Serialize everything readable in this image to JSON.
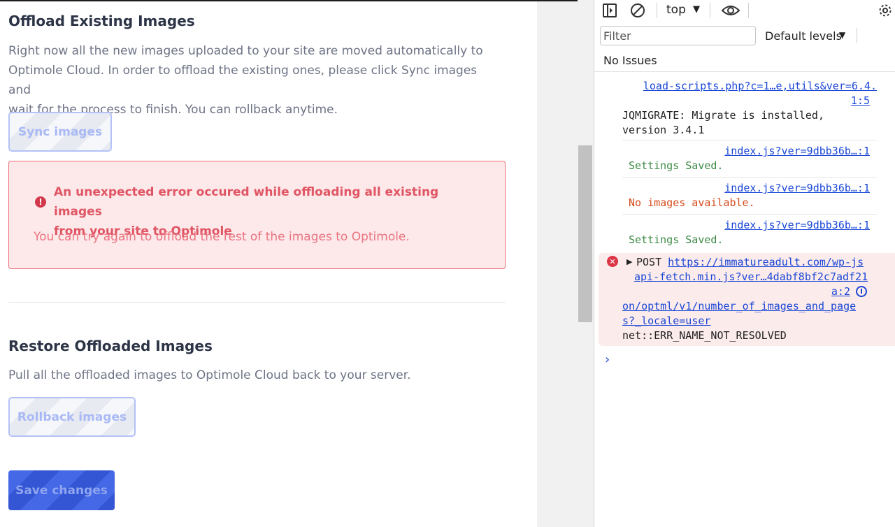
{
  "offload": {
    "title": "Offload Existing Images",
    "desc_1": "Right now all the new images uploaded to your site are moved automatically to",
    "desc_2": "Optimole Cloud. In order to offload the existing ones, please click Sync images and",
    "desc_3": "wait for the process to finish. You can rollback anytime.",
    "sync_label": "Sync images",
    "error_title_1": "An unexpected error occured while offloading all existing images",
    "error_title_2": "from your site to Optimole",
    "error_text": "You can try again to offload the rest of the images to Optimole."
  },
  "restore": {
    "title": "Restore Offloaded Images",
    "desc": "Pull all the offloaded images to Optimole Cloud back to your server.",
    "rollback_label": "Rollback images"
  },
  "save_label": "Save changes",
  "devtools": {
    "context": "top",
    "filter_placeholder": "Filter",
    "levels": "Default levels",
    "issues": "No Issues",
    "logs": [
      {
        "link_1": "load-scripts.php?c=1…e,utils&ver=6.4.",
        "link_2": "1:5",
        "msg_1": "JQMIGRATE: Migrate is installed,",
        "msg_2": "version 3.4.1"
      },
      {
        "link": "index.js?ver=9dbb36b…:1",
        "msg": "Settings Saved."
      },
      {
        "link": "index.js?ver=9dbb36b…:1",
        "msg": "No images available."
      },
      {
        "link": "index.js?ver=9dbb36b…:1",
        "msg": "Settings Saved."
      }
    ],
    "error": {
      "method": "POST",
      "url_1": "https://immatureadult.com/wp-js",
      "source_1": "api-fetch.min.js?ver…4dabf8bf2c7adf21",
      "source_2": "a:2",
      "url_2": "on/optml/v1/number_of_images_and_page",
      "url_3": "s?_locale=user",
      "message": "net::ERR_NAME_NOT_RESOLVED"
    },
    "prompt": "›"
  }
}
